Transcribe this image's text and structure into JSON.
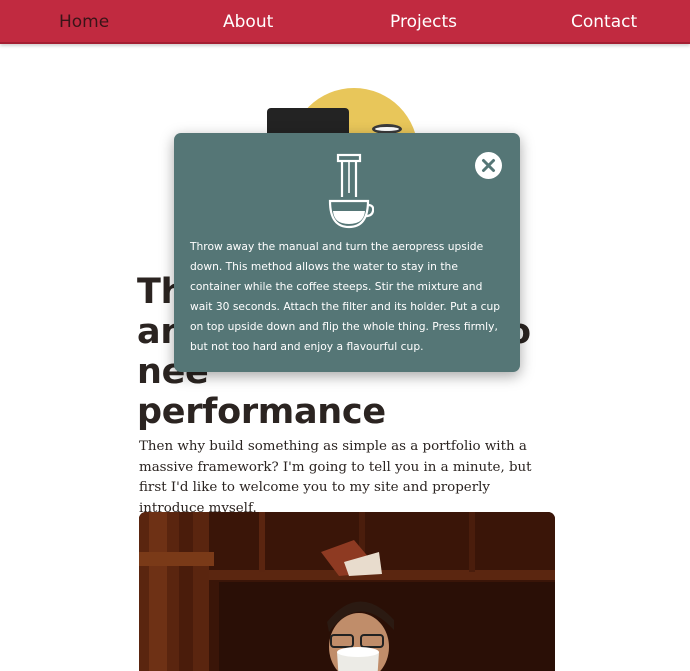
{
  "nav": {
    "items": [
      {
        "label": "Home",
        "active": true
      },
      {
        "label": "About",
        "active": false
      },
      {
        "label": "Projects",
        "active": false
      },
      {
        "label": "Contact",
        "active": false
      }
    ]
  },
  "article": {
    "headline_lines": [
      "Th",
      "an",
      "nee",
      "performance"
    ],
    "headline_line3_tail": "o",
    "lead": "Then why build something as simple as a portfolio with a massive framework? I'm going to tell you in a minute, but first I'd like to welcome you to my site and properly introduce myself."
  },
  "modal": {
    "icon": "aeropress-icon",
    "close_icon": "close-icon",
    "text": "Throw away the manual and turn the aeropress upside down. This method allows the water to stay in the container while the coffee steeps. Stir the mixture and wait 30 seconds. Attach the filter and its holder. Put a cup on top upside down and flip the whole thing. Press firmly, but not too hard and enjoy a flavourful cup."
  },
  "colors": {
    "nav_bg": "#c12a40",
    "nav_active_text": "#3a1418",
    "modal_bg": "#557676",
    "hero_circle": "#e8c65a",
    "body_text": "#2b2421"
  }
}
